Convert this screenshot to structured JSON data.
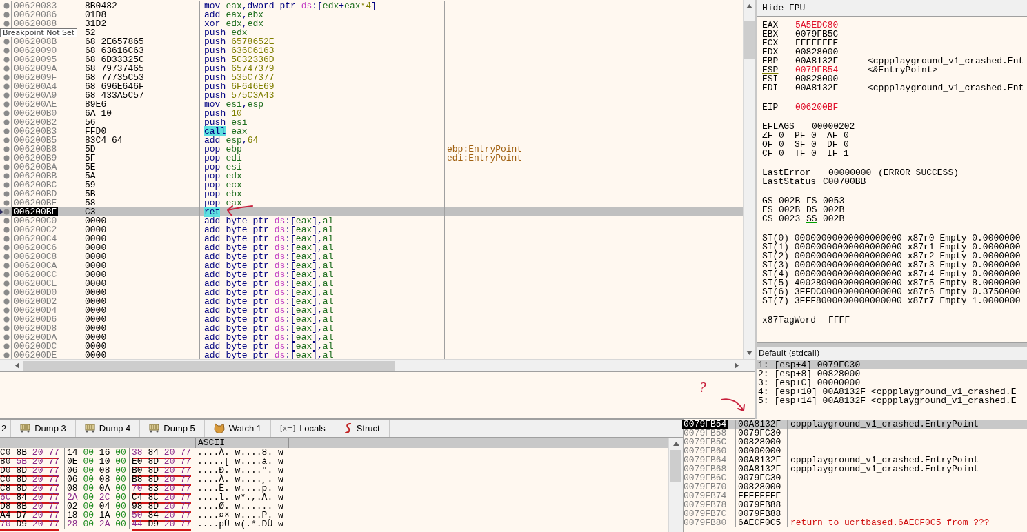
{
  "disassembly": {
    "tooltip": "Breakpoint Not Set",
    "rows": [
      {
        "address": "00620083",
        "bytes": "8B0482",
        "mnemonic": "mov",
        "highlight": false,
        "selected": false,
        "operands": [
          {
            "text": "eax",
            "kind": "reg"
          },
          {
            "text": ",dword ptr ",
            "kind": "plain"
          },
          {
            "text": "ds",
            "kind": "seg"
          },
          {
            "text": ":[",
            "kind": "plain"
          },
          {
            "text": "edx",
            "kind": "reg"
          },
          {
            "text": "+",
            "kind": "plain"
          },
          {
            "text": "eax",
            "kind": "reg"
          },
          {
            "text": "*4",
            "kind": "num"
          },
          {
            "text": "]",
            "kind": "plain"
          }
        ]
      },
      {
        "address": "00620086",
        "bytes": "01D8",
        "mnemonic": "add",
        "highlight": false,
        "selected": false,
        "operands": [
          {
            "text": "eax",
            "kind": "reg"
          },
          {
            "text": ",",
            "kind": "plain"
          },
          {
            "text": "ebx",
            "kind": "reg"
          }
        ]
      },
      {
        "address": "00620088",
        "bytes": "31D2",
        "mnemonic": "xor",
        "highlight": false,
        "selected": false,
        "operands": [
          {
            "text": "edx",
            "kind": "reg"
          },
          {
            "text": ",",
            "kind": "plain"
          },
          {
            "text": "edx",
            "kind": "reg"
          }
        ]
      },
      {
        "bytes": "52",
        "mnemonic": "push",
        "highlight": false,
        "selected": false,
        "operands": [
          {
            "text": "edx",
            "kind": "reg"
          }
        ]
      },
      {
        "address": "0062008B",
        "bytes": "68 2E657865",
        "mnemonic": "push",
        "highlight": false,
        "selected": false,
        "operands": [
          {
            "text": "6578652E",
            "kind": "num"
          }
        ]
      },
      {
        "address": "00620090",
        "bytes": "68 63616C63",
        "mnemonic": "push",
        "highlight": false,
        "selected": false,
        "operands": [
          {
            "text": "636C6163",
            "kind": "num"
          }
        ]
      },
      {
        "address": "00620095",
        "bytes": "68 6D33325C",
        "mnemonic": "push",
        "highlight": false,
        "selected": false,
        "operands": [
          {
            "text": "5C32336D",
            "kind": "num"
          }
        ]
      },
      {
        "address": "0062009A",
        "bytes": "68 79737465",
        "mnemonic": "push",
        "highlight": false,
        "selected": false,
        "operands": [
          {
            "text": "65747379",
            "kind": "num"
          }
        ]
      },
      {
        "address": "0062009F",
        "bytes": "68 77735C53",
        "mnemonic": "push",
        "highlight": false,
        "selected": false,
        "operands": [
          {
            "text": "535C7377",
            "kind": "num"
          }
        ]
      },
      {
        "address": "006200A4",
        "bytes": "68 696E646F",
        "mnemonic": "push",
        "highlight": false,
        "selected": false,
        "operands": [
          {
            "text": "6F646E69",
            "kind": "num"
          }
        ]
      },
      {
        "address": "006200A9",
        "bytes": "68 433A5C57",
        "mnemonic": "push",
        "highlight": false,
        "selected": false,
        "operands": [
          {
            "text": "575C3A43",
            "kind": "num"
          }
        ]
      },
      {
        "address": "006200AE",
        "bytes": "89E6",
        "mnemonic": "mov",
        "highlight": false,
        "selected": false,
        "operands": [
          {
            "text": "esi",
            "kind": "reg"
          },
          {
            "text": ",",
            "kind": "plain"
          },
          {
            "text": "esp",
            "kind": "reg"
          }
        ]
      },
      {
        "address": "006200B0",
        "bytes": "6A 10",
        "mnemonic": "push",
        "highlight": false,
        "selected": false,
        "operands": [
          {
            "text": "10",
            "kind": "num"
          }
        ]
      },
      {
        "address": "006200B2",
        "bytes": "56",
        "mnemonic": "push",
        "highlight": false,
        "selected": false,
        "operands": [
          {
            "text": "esi",
            "kind": "reg"
          }
        ]
      },
      {
        "address": "006200B3",
        "bytes": "FFD0",
        "mnemonic": "call",
        "highlight": true,
        "selected": false,
        "operands": [
          {
            "text": "eax",
            "kind": "reg"
          }
        ]
      },
      {
        "address": "006200B5",
        "bytes": "83C4 64",
        "mnemonic": "add",
        "highlight": false,
        "selected": false,
        "operands": [
          {
            "text": "esp",
            "kind": "reg"
          },
          {
            "text": ",",
            "kind": "plain"
          },
          {
            "text": "64",
            "kind": "num"
          }
        ]
      },
      {
        "address": "006200B8",
        "bytes": "5D",
        "mnemonic": "pop",
        "highlight": false,
        "selected": false,
        "operands": [
          {
            "text": "ebp",
            "kind": "reg"
          }
        ],
        "comment": "ebp:EntryPoint"
      },
      {
        "address": "006200B9",
        "bytes": "5F",
        "mnemonic": "pop",
        "highlight": false,
        "selected": false,
        "operands": [
          {
            "text": "edi",
            "kind": "reg"
          }
        ],
        "comment": "edi:EntryPoint"
      },
      {
        "address": "006200BA",
        "bytes": "5E",
        "mnemonic": "pop",
        "highlight": false,
        "selected": false,
        "operands": [
          {
            "text": "esi",
            "kind": "reg"
          }
        ]
      },
      {
        "address": "006200BB",
        "bytes": "5A",
        "mnemonic": "pop",
        "highlight": false,
        "selected": false,
        "operands": [
          {
            "text": "edx",
            "kind": "reg"
          }
        ]
      },
      {
        "address": "006200BC",
        "bytes": "59",
        "mnemonic": "pop",
        "highlight": false,
        "selected": false,
        "operands": [
          {
            "text": "ecx",
            "kind": "reg"
          }
        ]
      },
      {
        "address": "006200BD",
        "bytes": "5B",
        "mnemonic": "pop",
        "highlight": false,
        "selected": false,
        "operands": [
          {
            "text": "ebx",
            "kind": "reg"
          }
        ]
      },
      {
        "address": "006200BE",
        "bytes": "58",
        "mnemonic": "pop",
        "highlight": false,
        "selected": false,
        "operands": [
          {
            "text": "eax",
            "kind": "reg"
          }
        ]
      },
      {
        "address": "006200BF",
        "bytes": "C3",
        "mnemonic": "ret",
        "highlight": true,
        "selected": true,
        "operands": []
      },
      {
        "address": "006200C0",
        "bytes": "0000",
        "mnemonic": "add",
        "highlight": false,
        "selected": false,
        "operands": [
          {
            "text": "byte ptr ",
            "kind": "plain"
          },
          {
            "text": "ds",
            "kind": "seg"
          },
          {
            "text": ":[",
            "kind": "plain"
          },
          {
            "text": "eax",
            "kind": "reg"
          },
          {
            "text": "],",
            "kind": "plain"
          },
          {
            "text": "al",
            "kind": "reg"
          }
        ]
      },
      {
        "address": "006200C2",
        "bytes": "0000",
        "mnemonic": "add",
        "highlight": false,
        "selected": false,
        "operands": [
          {
            "text": "byte ptr ",
            "kind": "plain"
          },
          {
            "text": "ds",
            "kind": "seg"
          },
          {
            "text": ":[",
            "kind": "plain"
          },
          {
            "text": "eax",
            "kind": "reg"
          },
          {
            "text": "],",
            "kind": "plain"
          },
          {
            "text": "al",
            "kind": "reg"
          }
        ]
      },
      {
        "address": "006200C4",
        "bytes": "0000",
        "mnemonic": "add",
        "highlight": false,
        "selected": false,
        "operands": [
          {
            "text": "byte ptr ",
            "kind": "plain"
          },
          {
            "text": "ds",
            "kind": "seg"
          },
          {
            "text": ":[",
            "kind": "plain"
          },
          {
            "text": "eax",
            "kind": "reg"
          },
          {
            "text": "],",
            "kind": "plain"
          },
          {
            "text": "al",
            "kind": "reg"
          }
        ]
      },
      {
        "address": "006200C6",
        "bytes": "0000",
        "mnemonic": "add",
        "highlight": false,
        "selected": false,
        "operands": [
          {
            "text": "byte ptr ",
            "kind": "plain"
          },
          {
            "text": "ds",
            "kind": "seg"
          },
          {
            "text": ":[",
            "kind": "plain"
          },
          {
            "text": "eax",
            "kind": "reg"
          },
          {
            "text": "],",
            "kind": "plain"
          },
          {
            "text": "al",
            "kind": "reg"
          }
        ]
      },
      {
        "address": "006200C8",
        "bytes": "0000",
        "mnemonic": "add",
        "highlight": false,
        "selected": false,
        "operands": [
          {
            "text": "byte ptr ",
            "kind": "plain"
          },
          {
            "text": "ds",
            "kind": "seg"
          },
          {
            "text": ":[",
            "kind": "plain"
          },
          {
            "text": "eax",
            "kind": "reg"
          },
          {
            "text": "],",
            "kind": "plain"
          },
          {
            "text": "al",
            "kind": "reg"
          }
        ]
      },
      {
        "address": "006200CA",
        "bytes": "0000",
        "mnemonic": "add",
        "highlight": false,
        "selected": false,
        "operands": [
          {
            "text": "byte ptr ",
            "kind": "plain"
          },
          {
            "text": "ds",
            "kind": "seg"
          },
          {
            "text": ":[",
            "kind": "plain"
          },
          {
            "text": "eax",
            "kind": "reg"
          },
          {
            "text": "],",
            "kind": "plain"
          },
          {
            "text": "al",
            "kind": "reg"
          }
        ]
      },
      {
        "address": "006200CC",
        "bytes": "0000",
        "mnemonic": "add",
        "highlight": false,
        "selected": false,
        "operands": [
          {
            "text": "byte ptr ",
            "kind": "plain"
          },
          {
            "text": "ds",
            "kind": "seg"
          },
          {
            "text": ":[",
            "kind": "plain"
          },
          {
            "text": "eax",
            "kind": "reg"
          },
          {
            "text": "],",
            "kind": "plain"
          },
          {
            "text": "al",
            "kind": "reg"
          }
        ]
      },
      {
        "address": "006200CE",
        "bytes": "0000",
        "mnemonic": "add",
        "highlight": false,
        "selected": false,
        "operands": [
          {
            "text": "byte ptr ",
            "kind": "plain"
          },
          {
            "text": "ds",
            "kind": "seg"
          },
          {
            "text": ":[",
            "kind": "plain"
          },
          {
            "text": "eax",
            "kind": "reg"
          },
          {
            "text": "],",
            "kind": "plain"
          },
          {
            "text": "al",
            "kind": "reg"
          }
        ]
      },
      {
        "address": "006200D0",
        "bytes": "0000",
        "mnemonic": "add",
        "highlight": false,
        "selected": false,
        "operands": [
          {
            "text": "byte ptr ",
            "kind": "plain"
          },
          {
            "text": "ds",
            "kind": "seg"
          },
          {
            "text": ":[",
            "kind": "plain"
          },
          {
            "text": "eax",
            "kind": "reg"
          },
          {
            "text": "],",
            "kind": "plain"
          },
          {
            "text": "al",
            "kind": "reg"
          }
        ]
      },
      {
        "address": "006200D2",
        "bytes": "0000",
        "mnemonic": "add",
        "highlight": false,
        "selected": false,
        "operands": [
          {
            "text": "byte ptr ",
            "kind": "plain"
          },
          {
            "text": "ds",
            "kind": "seg"
          },
          {
            "text": ":[",
            "kind": "plain"
          },
          {
            "text": "eax",
            "kind": "reg"
          },
          {
            "text": "],",
            "kind": "plain"
          },
          {
            "text": "al",
            "kind": "reg"
          }
        ]
      },
      {
        "address": "006200D4",
        "bytes": "0000",
        "mnemonic": "add",
        "highlight": false,
        "selected": false,
        "operands": [
          {
            "text": "byte ptr ",
            "kind": "plain"
          },
          {
            "text": "ds",
            "kind": "seg"
          },
          {
            "text": ":[",
            "kind": "plain"
          },
          {
            "text": "eax",
            "kind": "reg"
          },
          {
            "text": "],",
            "kind": "plain"
          },
          {
            "text": "al",
            "kind": "reg"
          }
        ]
      },
      {
        "address": "006200D6",
        "bytes": "0000",
        "mnemonic": "add",
        "highlight": false,
        "selected": false,
        "operands": [
          {
            "text": "byte ptr ",
            "kind": "plain"
          },
          {
            "text": "ds",
            "kind": "seg"
          },
          {
            "text": ":[",
            "kind": "plain"
          },
          {
            "text": "eax",
            "kind": "reg"
          },
          {
            "text": "],",
            "kind": "plain"
          },
          {
            "text": "al",
            "kind": "reg"
          }
        ]
      },
      {
        "address": "006200D8",
        "bytes": "0000",
        "mnemonic": "add",
        "highlight": false,
        "selected": false,
        "operands": [
          {
            "text": "byte ptr ",
            "kind": "plain"
          },
          {
            "text": "ds",
            "kind": "seg"
          },
          {
            "text": ":[",
            "kind": "plain"
          },
          {
            "text": "eax",
            "kind": "reg"
          },
          {
            "text": "],",
            "kind": "plain"
          },
          {
            "text": "al",
            "kind": "reg"
          }
        ]
      },
      {
        "address": "006200DA",
        "bytes": "0000",
        "mnemonic": "add",
        "highlight": false,
        "selected": false,
        "operands": [
          {
            "text": "byte ptr ",
            "kind": "plain"
          },
          {
            "text": "ds",
            "kind": "seg"
          },
          {
            "text": ":[",
            "kind": "plain"
          },
          {
            "text": "eax",
            "kind": "reg"
          },
          {
            "text": "],",
            "kind": "plain"
          },
          {
            "text": "al",
            "kind": "reg"
          }
        ]
      },
      {
        "address": "006200DC",
        "bytes": "0000",
        "mnemonic": "add",
        "highlight": false,
        "selected": false,
        "operands": [
          {
            "text": "byte ptr ",
            "kind": "plain"
          },
          {
            "text": "ds",
            "kind": "seg"
          },
          {
            "text": ":[",
            "kind": "plain"
          },
          {
            "text": "eax",
            "kind": "reg"
          },
          {
            "text": "],",
            "kind": "plain"
          },
          {
            "text": "al",
            "kind": "reg"
          }
        ]
      },
      {
        "address": "006200DE",
        "bytes": "0000",
        "mnemonic": "add",
        "highlight": false,
        "selected": false,
        "operands": [
          {
            "text": "byte ptr ",
            "kind": "plain"
          },
          {
            "text": "ds",
            "kind": "seg"
          },
          {
            "text": ":[",
            "kind": "plain"
          },
          {
            "text": "eax",
            "kind": "reg"
          },
          {
            "text": "],",
            "kind": "plain"
          },
          {
            "text": "al",
            "kind": "reg"
          }
        ]
      }
    ]
  },
  "annotation": {
    "text": "?"
  },
  "registers_panel": {
    "header_button": "Hide FPU",
    "registers": [
      {
        "name": "EAX",
        "value": "5A5EDC80",
        "changed": true,
        "underlined": false
      },
      {
        "name": "EBX",
        "value": "0079FB5C",
        "changed": false,
        "underlined": false
      },
      {
        "name": "ECX",
        "value": "FFFFFFFE",
        "changed": false,
        "underlined": false
      },
      {
        "name": "EDX",
        "value": "00828000",
        "changed": false,
        "underlined": false
      },
      {
        "name": "EBP",
        "value": "00A8132F",
        "changed": false,
        "underlined": false,
        "comment": "<cppplayground_v1_crashed.Ent"
      },
      {
        "name": "ESP",
        "value": "0079FB54",
        "changed": true,
        "underlined": true,
        "comment": "<&EntryPoint>"
      },
      {
        "name": "ESI",
        "value": "00828000",
        "changed": false,
        "underlined": false
      },
      {
        "name": "EDI",
        "value": "00A8132F",
        "changed": false,
        "underlined": false,
        "comment": "<cppplayground_v1_crashed.Ent"
      }
    ],
    "eip": {
      "name": "EIP",
      "value": "006200BF",
      "changed": true
    },
    "eflags": {
      "name": "EFLAGS",
      "value": "00000202"
    },
    "flag_rows": [
      [
        {
          "name": "ZF",
          "value": "0"
        },
        {
          "name": "PF",
          "value": "0"
        },
        {
          "name": "AF",
          "value": "0"
        }
      ],
      [
        {
          "name": "OF",
          "value": "0"
        },
        {
          "name": "SF",
          "value": "0"
        },
        {
          "name": "DF",
          "value": "0"
        }
      ],
      [
        {
          "name": "CF",
          "value": "0"
        },
        {
          "name": "TF",
          "value": "0"
        },
        {
          "name": "IF",
          "value": "1"
        }
      ]
    ],
    "last_error": {
      "label": "LastError",
      "value": "00000000",
      "note": "(ERROR_SUCCESS)"
    },
    "last_status": {
      "label": "LastStatus",
      "value": "C00700BB"
    },
    "segment_rows": [
      [
        {
          "name": "GS",
          "value": "002B",
          "underlined": false
        },
        {
          "name": "FS",
          "value": "0053",
          "underlined": false
        }
      ],
      [
        {
          "name": "ES",
          "value": "002B",
          "underlined": false
        },
        {
          "name": "DS",
          "value": "002B",
          "underlined": false
        }
      ],
      [
        {
          "name": "CS",
          "value": "0023",
          "underlined": false
        },
        {
          "name": "SS",
          "value": "002B",
          "underlined": true
        }
      ]
    ],
    "fpu": [
      "ST(0) 00000000000000000000 x87r0 Empty 0.0000000",
      "ST(1) 00000000000000000000 x87r1 Empty 0.0000000",
      "ST(2) 00000000000000000000 x87r2 Empty 0.0000000",
      "ST(3) 00000000000000000000 x87r3 Empty 0.0000000",
      "ST(4) 00000000000000000000 x87r4 Empty 0.0000000",
      "ST(5) 40028000000000000000 x87r5 Empty 8.0000000",
      "ST(6) 3FFDC000000000000000 x87r6 Empty 0.3750000",
      "ST(7) 3FFF8000000000000000 x87r7 Empty 1.0000000"
    ],
    "tag_word": {
      "label": "x87TagWord",
      "value": "FFFF"
    }
  },
  "arguments": {
    "convention": "Default (stdcall)",
    "rows": [
      {
        "text": "1: [esp+4] 0079FC30",
        "selected": true
      },
      {
        "text": "2: [esp+8] 00828000",
        "selected": false
      },
      {
        "text": "3: [esp+C] 00000000",
        "selected": false
      },
      {
        "text": "4: [esp+10] 00A8132F <cppplayground_v1_crashed.E",
        "selected": false
      },
      {
        "text": "5: [esp+14] 00A8132F <cppplayground_v1_crashed.E",
        "selected": false
      }
    ]
  },
  "dump": {
    "tabs": [
      {
        "label": "2",
        "selected": false
      },
      {
        "label": "Dump 3",
        "kind": "memory",
        "selected": false
      },
      {
        "label": "Dump 4",
        "kind": "memory",
        "selected": false
      },
      {
        "label": "Dump 5",
        "kind": "memory",
        "selected": false
      },
      {
        "label": "Watch 1",
        "kind": "animal",
        "selected": false
      },
      {
        "label": "Locals",
        "kind": "glyph",
        "glyph": "[x=]",
        "selected": false
      },
      {
        "label": "Struct",
        "kind": "hook",
        "selected": false
      }
    ],
    "ascii_header": "ASCII",
    "rows": [
      {
        "groups": [
          {
            "bytes": "C0 8B 20 77",
            "pointer": true
          },
          {
            "bytes": "14 00 16 00",
            "pointer": false
          },
          {
            "bytes": "38 84 20 77",
            "pointer": true
          }
        ],
        "ascii": "....À. w....8. w"
      },
      {
        "groups": [
          {
            "bytes": "80 5B 20 77",
            "pointer": true
          },
          {
            "bytes": "0E 00 10 00",
            "pointer": false
          },
          {
            "bytes": "E0 8D 20 77",
            "pointer": true
          }
        ],
        "ascii": ".....[ w....à. w"
      },
      {
        "groups": [
          {
            "bytes": "D0 8D 20 77",
            "pointer": true
          },
          {
            "bytes": "06 00 08 00",
            "pointer": false
          },
          {
            "bytes": "B0 8D 20 77",
            "pointer": true
          }
        ],
        "ascii": "....Ð. w....°. w"
      },
      {
        "groups": [
          {
            "bytes": "C0 8D 20 77",
            "pointer": true
          },
          {
            "bytes": "06 00 08 00",
            "pointer": false
          },
          {
            "bytes": "B8 8D 20 77",
            "pointer": true
          }
        ],
        "ascii": "....À. w....¸. w"
      },
      {
        "groups": [
          {
            "bytes": "C8 8D 20 77",
            "pointer": true
          },
          {
            "bytes": "08 00 0A 00",
            "pointer": false
          },
          {
            "bytes": "70 83 20 77",
            "pointer": true
          }
        ],
        "ascii": "....È. w....p. w"
      },
      {
        "groups": [
          {
            "bytes": "6C 84 20 77",
            "pointer": true
          },
          {
            "bytes": "2A 00 2C 00",
            "pointer": false
          },
          {
            "bytes": "C4 8C 20 77",
            "pointer": true
          }
        ],
        "ascii": "....l. w*.,.Ä. w"
      },
      {
        "groups": [
          {
            "bytes": "D8 8B 20 77",
            "pointer": true
          },
          {
            "bytes": "02 00 04 00",
            "pointer": false
          },
          {
            "bytes": "98 8D 20 77",
            "pointer": true
          }
        ],
        "ascii": "....Ø. w...... w"
      },
      {
        "groups": [
          {
            "bytes": "A4 D7 20 77",
            "pointer": true
          },
          {
            "bytes": "18 00 1A 00",
            "pointer": false
          },
          {
            "bytes": "50 84 20 77",
            "pointer": true
          }
        ],
        "ascii": "....¤× w....P. w"
      },
      {
        "groups": [
          {
            "bytes": "70 D9 20 77",
            "pointer": true
          },
          {
            "bytes": "28 00 2A 00",
            "pointer": false
          },
          {
            "bytes": "44 D9 20 77",
            "pointer": true
          }
        ],
        "ascii": "....pÙ w(.*.DÙ w"
      }
    ]
  },
  "stack": {
    "rows": [
      {
        "address": "0079FB54",
        "value": "00A8132F",
        "comment": "cppplayground_v1_crashed.EntryPoint",
        "kind": "label",
        "selected": true
      },
      {
        "address": "0079FB58",
        "value": "0079FC30",
        "selected": false
      },
      {
        "address": "0079FB5C",
        "value": "00828000",
        "selected": false
      },
      {
        "address": "0079FB60",
        "value": "00000000",
        "selected": false
      },
      {
        "address": "0079FB64",
        "value": "00A8132F",
        "comment": "cppplayground_v1_crashed.EntryPoint",
        "kind": "label",
        "selected": false
      },
      {
        "address": "0079FB68",
        "value": "00A8132F",
        "comment": "cppplayground_v1_crashed.EntryPoint",
        "kind": "label",
        "selected": false
      },
      {
        "address": "0079FB6C",
        "value": "0079FC30",
        "selected": false
      },
      {
        "address": "0079FB70",
        "value": "00828000",
        "selected": false
      },
      {
        "address": "0079FB74",
        "value": "FFFFFFFE",
        "selected": false
      },
      {
        "address": "0079FB78",
        "value": "0079FB88",
        "selected": false
      },
      {
        "address": "0079FB7C",
        "value": "0079FB88",
        "selected": false
      },
      {
        "address": "0079FB80",
        "value": "6AECF0C5",
        "comment": "return to ucrtbased.6AECF0C5 from ???",
        "kind": "return",
        "selected": false
      }
    ]
  }
}
